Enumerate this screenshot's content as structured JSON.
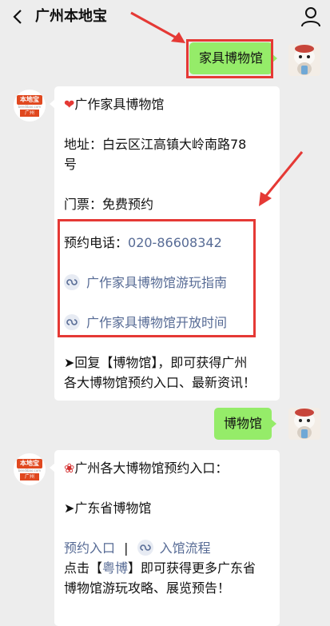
{
  "header": {
    "back_icon": "chevron-left-icon",
    "title": "广州本地宝",
    "profile_icon": "person-icon"
  },
  "colors": {
    "bubble_green": "#95ec69",
    "link": "#576b95",
    "highlight_red": "#e53935"
  },
  "bot_logo": {
    "top": "本地宝",
    "mid": "bendibao.com",
    "city": "广州"
  },
  "messages": [
    {
      "from": "user",
      "text": "家具博物馆"
    },
    {
      "from": "bot",
      "title": "广作家具博物馆",
      "address_line1": "地址：白云区江高镇大岭南路78",
      "address_line2": "号",
      "ticket": "门票：免费预约",
      "phone_label": "预约电话：",
      "phone_number": "020-86608342",
      "link1": "广作家具博物馆游玩指南",
      "link2": "广作家具博物馆开放时间",
      "reply_line1": "➤回复【博物馆】，即可获得广州",
      "reply_line2": "各大博物馆预约入口、最新资讯！"
    },
    {
      "from": "user",
      "text": "博物馆"
    },
    {
      "from": "bot",
      "title": "广州各大博物馆预约入口：",
      "item1": "➤广东省博物馆",
      "booking_link": "预约入口",
      "separator": "|",
      "visit_link": "入馆流程",
      "tip_prefix": "点击【",
      "tip_link": "粤博",
      "tip_suffix_line1": "】即可获得更多广东省",
      "tip_line2": "博物馆游玩攻略、展览预告！"
    }
  ]
}
